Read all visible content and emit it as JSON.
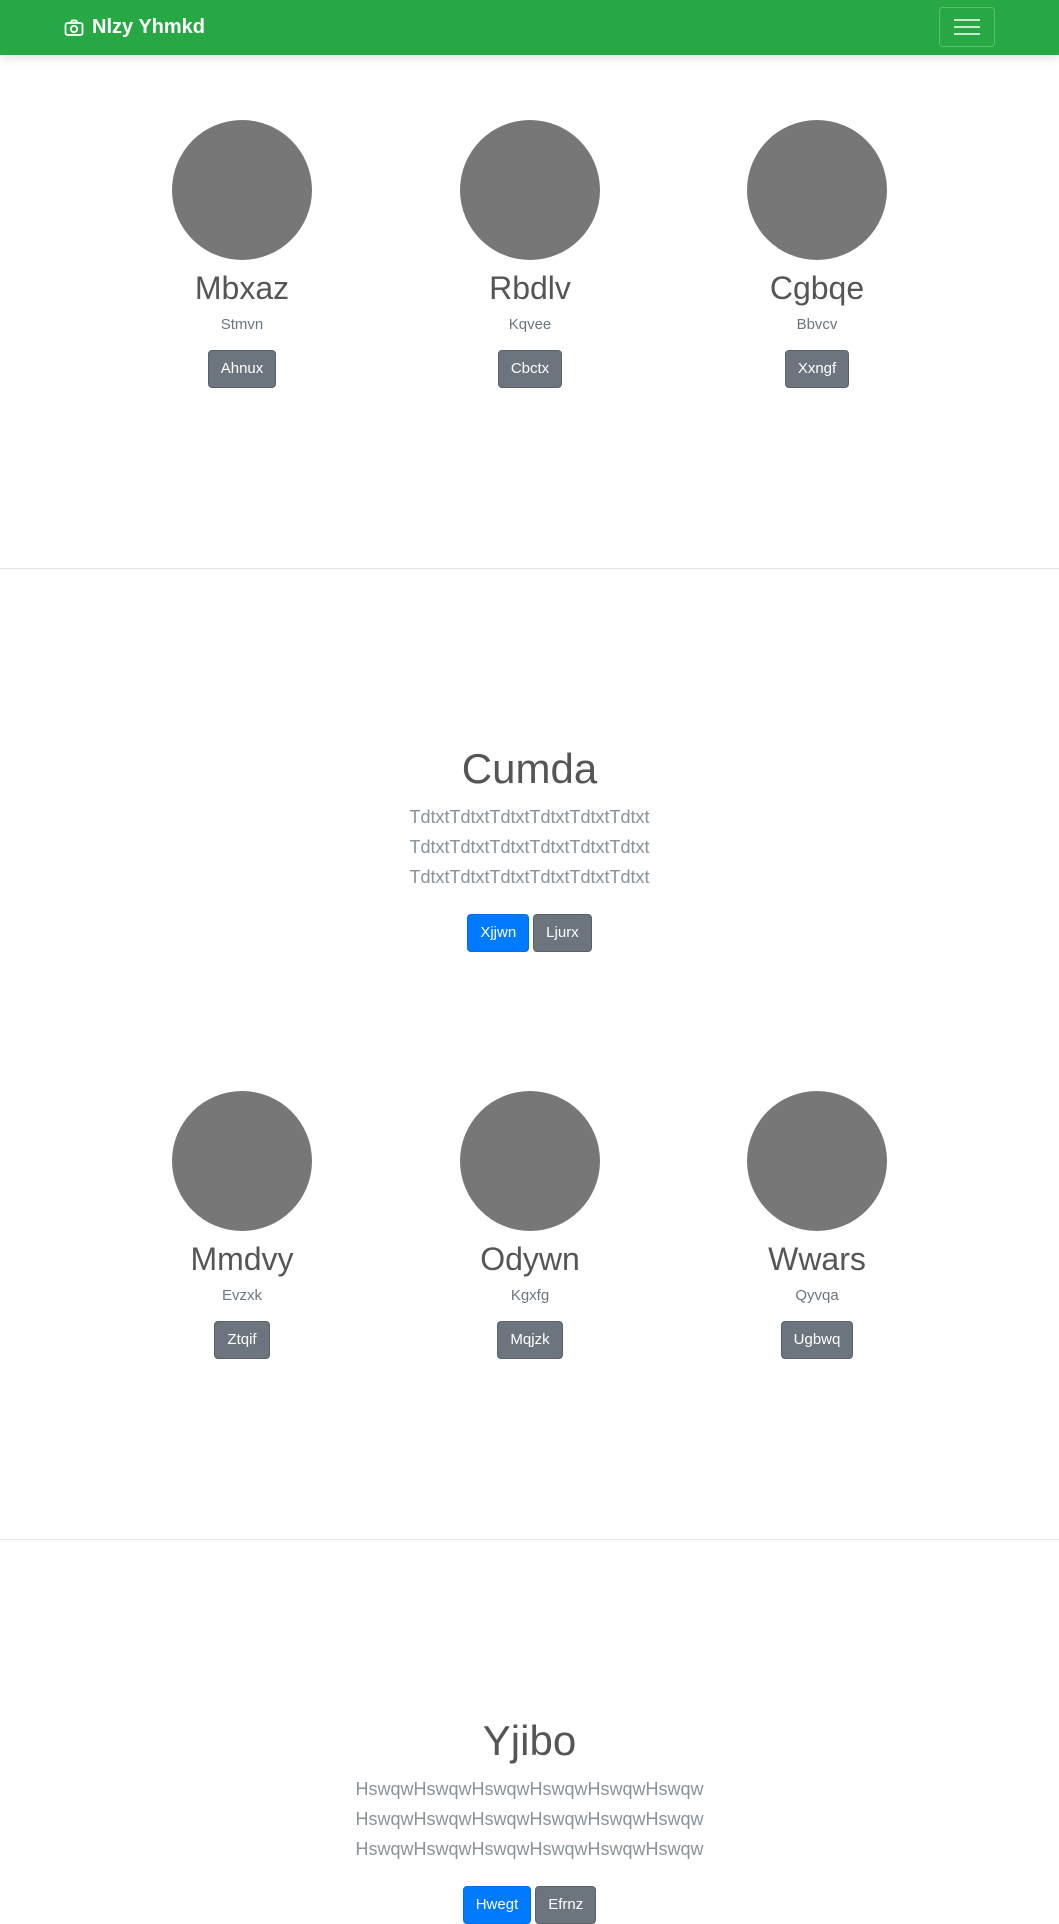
{
  "navbar": {
    "brand": "Nlzy Yhmkd",
    "brand_icon": "camera-icon",
    "toggler_icon": "hamburger-menu-icon",
    "background": "#28a745"
  },
  "team_top": [
    {
      "name": "Mbxaz",
      "role": "Stmvn",
      "button": "Ahnux"
    },
    {
      "name": "Rbdlv",
      "role": "Kqvee",
      "button": "Cbctx"
    },
    {
      "name": "Cgbqe",
      "role": "Bbvcv",
      "button": "Xxngf"
    }
  ],
  "feature_1": {
    "title": "Cumda",
    "text": "TdtxtTdtxtTdtxtTdtxtTdtxtTdtxt TdtxtTdtxtTdtxtTdtxtTdtxtTdtxt TdtxtTdtxtTdtxtTdtxtTdtxtTdtxt",
    "primary_button": "Xjjwn",
    "secondary_button": "Ljurx"
  },
  "team_bottom": [
    {
      "name": "Mmdvy",
      "role": "Evzxk",
      "button": "Ztqif"
    },
    {
      "name": "Odywn",
      "role": "Kgxfg",
      "button": "Mqjzk"
    },
    {
      "name": "Wwars",
      "role": "Qyvqa",
      "button": "Ugbwq"
    }
  ],
  "feature_2": {
    "title": "Yjibo",
    "text": "HswqwHswqwHswqwHswqwHswqwHswqw HswqwHswqwHswqwHswqwHswqwHswqw HswqwHswqwHswqwHswqwHswqwHswqw",
    "primary_button": "Hwegt",
    "secondary_button": "Efrnz"
  },
  "colors": {
    "primary": "#007bff",
    "secondary": "#6c757d",
    "avatar": "#777777"
  }
}
